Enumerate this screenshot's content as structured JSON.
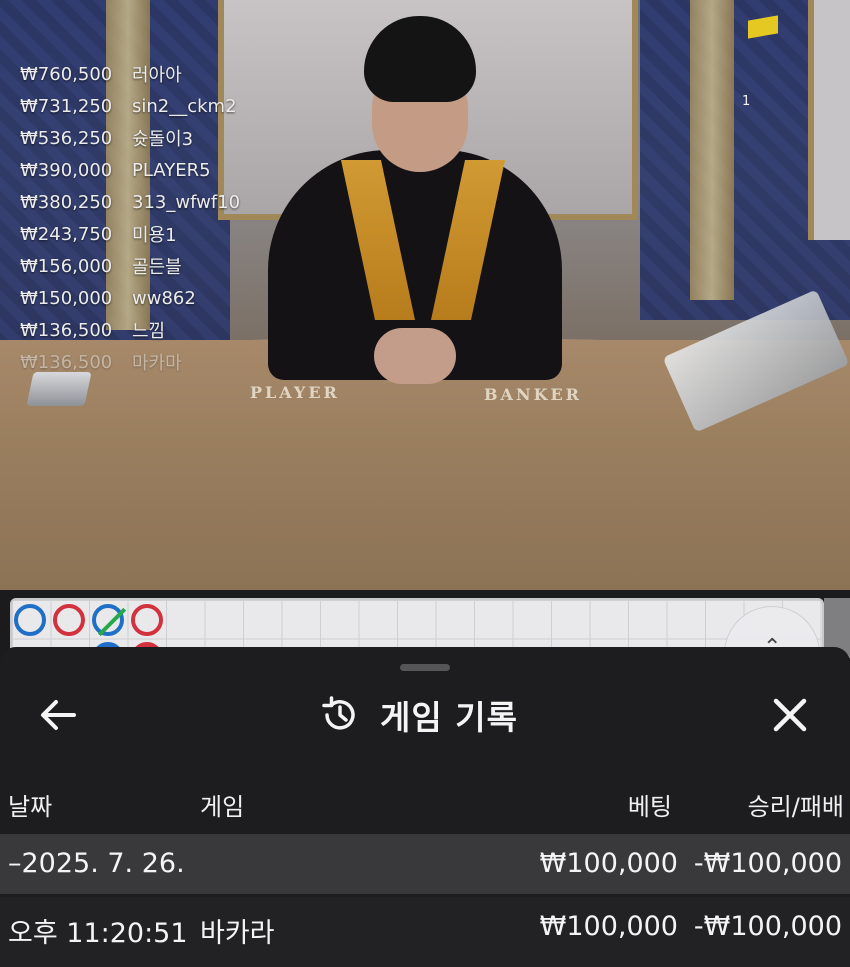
{
  "leaderboard": [
    {
      "amount": "₩760,500",
      "name": "러아아"
    },
    {
      "amount": "₩731,250",
      "name": "sin2__ckm2"
    },
    {
      "amount": "₩536,250",
      "name": "슛돌이3"
    },
    {
      "amount": "₩390,000",
      "name": "PLAYER5"
    },
    {
      "amount": "₩380,250",
      "name": "313_wfwf10"
    },
    {
      "amount": "₩243,750",
      "name": "미용1"
    },
    {
      "amount": "₩156,000",
      "name": "골든블"
    },
    {
      "amount": "₩150,000",
      "name": "ww862"
    },
    {
      "amount": "₩136,500",
      "name": "느낌"
    },
    {
      "amount": "₩136,500",
      "name": "마카마"
    }
  ],
  "video": {
    "table_player_label": "PLAYER",
    "table_banker_label": "BANKER",
    "overlay_marker": "1"
  },
  "roadmap": {
    "beads": [
      "player",
      "banker",
      "tie",
      "banker"
    ]
  },
  "sheet": {
    "title": "게임 기록",
    "title_icon": "history-icon",
    "back_icon": "arrow-left-icon",
    "close_icon": "close-icon",
    "columns": {
      "date": "날짜",
      "game": "게임",
      "bet": "베팅",
      "result": "승리/패배"
    },
    "date_group": {
      "label": "–2025. 7. 26.",
      "bet": "₩100,000",
      "result": "-₩100,000"
    },
    "rows": [
      {
        "time": "오후 11:20:51",
        "game": "바카라",
        "bet": "₩100,000",
        "result": "-₩100,000"
      }
    ]
  },
  "colors": {
    "sheet_bg": "#1d1d1f",
    "date_row_bg": "#39393c",
    "player_blue": "#1f6fc6",
    "banker_red": "#d2323d",
    "tie_green": "#26a84a"
  }
}
